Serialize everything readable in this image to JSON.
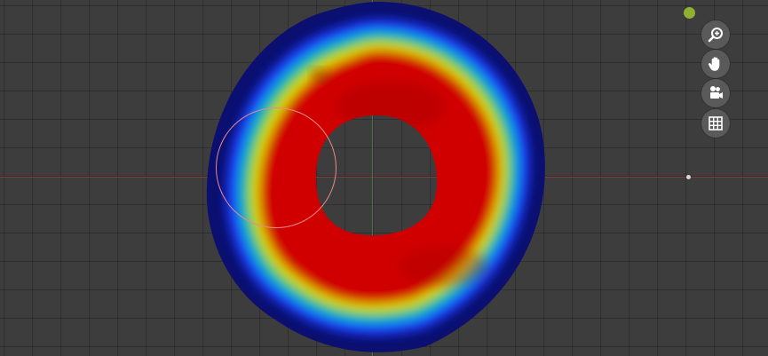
{
  "viewport": {
    "colors": {
      "background": "#3d3d3d",
      "axis_x": "#8a3a3a",
      "axis_y": "#4b7a3f",
      "brush_circle": "#e88a8a",
      "heatmap_high": "#d00000",
      "heatmap_mid": "#ffee00",
      "heatmap_low": "#0a0f70"
    }
  },
  "navigation": {
    "buttons": [
      {
        "name": "zoom",
        "icon": "zoom-in-icon"
      },
      {
        "name": "pan",
        "icon": "hand-icon"
      },
      {
        "name": "camera",
        "icon": "camera-icon"
      },
      {
        "name": "toggle-grid",
        "icon": "grid-icon"
      }
    ]
  }
}
